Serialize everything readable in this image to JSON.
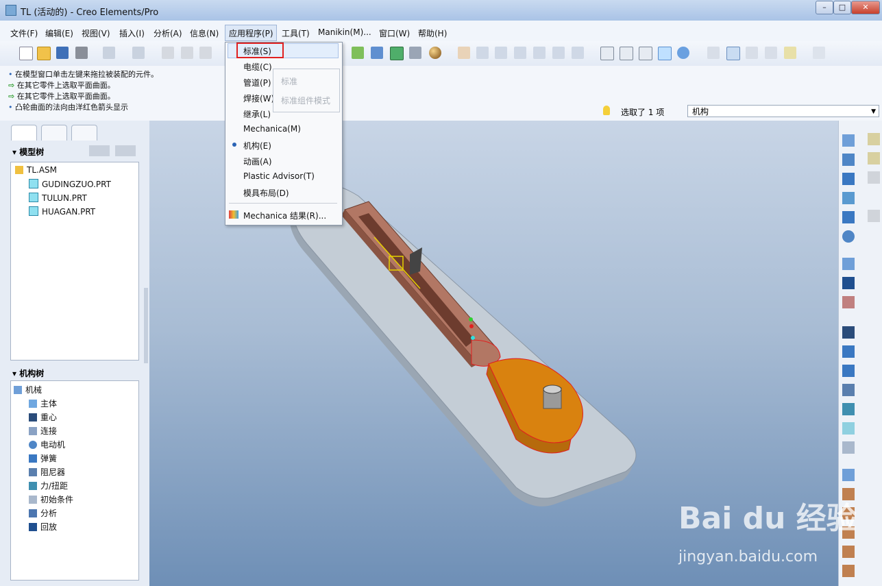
{
  "window": {
    "title": "TL (活动的) - Creo Elements/Pro",
    "controls": [
      "–",
      "□",
      "✕"
    ]
  },
  "menubar": [
    "文件(F)",
    "编辑(E)",
    "视图(V)",
    "插入(I)",
    "分析(A)",
    "信息(N)",
    "应用程序(P)",
    "工具(T)",
    "Manikin(M)...",
    "窗口(W)",
    "帮助(H)"
  ],
  "messages": [
    {
      "marker": "•",
      "text": "在模型窗口单击左键来拖拉被装配的元件。"
    },
    {
      "marker": "⇨",
      "text": "在其它零件上选取平面曲面。"
    },
    {
      "marker": "⇨",
      "text": "在其它零件上选取平面曲面。"
    },
    {
      "marker": "•",
      "text": "凸轮曲面的法向由洋红色箭头显示"
    }
  ],
  "selection": {
    "status": "选取了 1 项",
    "filter": "机构",
    "filter_arrow": "▼"
  },
  "model_tree": {
    "title": "模型树",
    "root": "TL.ASM",
    "items": [
      "GUDINGZUO.PRT",
      "TULUN.PRT",
      "HUAGAN.PRT"
    ]
  },
  "mechanism_tree": {
    "title": "机构树",
    "root": "机械",
    "items": [
      "主体",
      "重心",
      "连接",
      "电动机",
      "弹簧",
      "阻尼器",
      "力/扭距",
      "初始条件",
      "分析",
      "回放"
    ]
  },
  "dropdown": {
    "items": [
      "标准(S)",
      "电缆(C)",
      "管道(P)",
      "焊接(W)",
      "继承(L)",
      "Mechanica(M)",
      "机构(E)",
      "动画(A)",
      "Plastic Advisor(T)",
      "模具布局(D)"
    ],
    "last_item": "Mechanica 结果(R)...",
    "selected": "机构(E)",
    "submenu": [
      "标准",
      "标准组件模式"
    ]
  },
  "watermark": {
    "brand": "Bai du 经验",
    "url": "jingyan.baidu.com"
  },
  "colors": {
    "accent": "#2b64b5",
    "highlight_box": "#e02020",
    "base_plate": "#b8c3cd",
    "slider_part": "#a86a55",
    "cam_part": "#d9820f"
  }
}
